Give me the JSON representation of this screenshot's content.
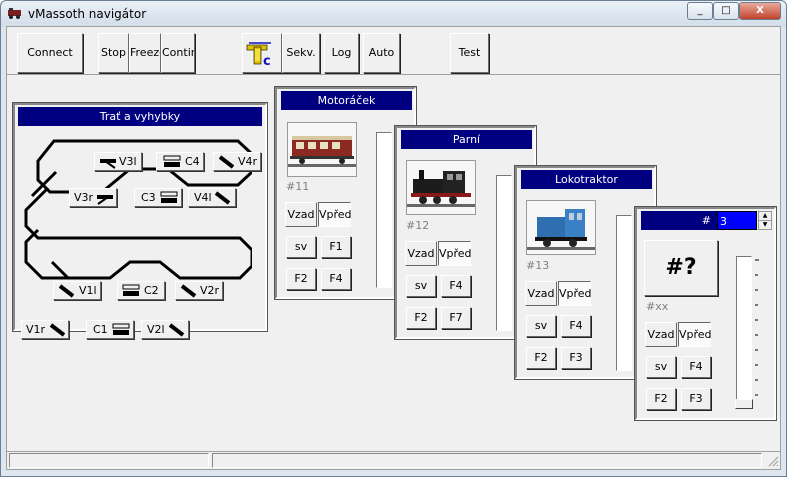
{
  "window": {
    "title": "vMassoth navigátor",
    "minimize": "_",
    "maximize": "□",
    "close": "X"
  },
  "toolbar": {
    "connect": "Connect",
    "stop": "Stop",
    "freeze": "Freeze",
    "continue": "Continu",
    "sekv": "Sekv.",
    "log": "Log",
    "auto": "Auto",
    "test": "Test"
  },
  "track": {
    "title": "Trať a vyhybky",
    "switches": {
      "v3l": "V3l",
      "c4": "C4",
      "v4r": "V4r",
      "v3r": "V3r",
      "c3": "C3",
      "v4l": "V4l",
      "v1l": "V1l",
      "c2": "C2",
      "v2r": "V2r",
      "v1r": "V1r",
      "c1": "C1",
      "v2l": "V2l"
    }
  },
  "locos": [
    {
      "name": "Motoráček",
      "number": "#11",
      "reverse": "Vzad",
      "forward": "Vpřed",
      "light": "sv",
      "f1": "F1",
      "f2": "F2",
      "f3": "F4"
    },
    {
      "name": "Parní",
      "number": "#12",
      "reverse": "Vzad",
      "forward": "Vpřed",
      "light": "sv",
      "f1": "F4",
      "f2": "F2",
      "f3": "F7"
    },
    {
      "name": "Lokotraktor",
      "number": "#13",
      "reverse": "Vzad",
      "forward": "Vpřed",
      "light": "sv",
      "f1": "F4",
      "f2": "F2",
      "f3": "F3"
    }
  ],
  "custom": {
    "hash": "#",
    "value": "3",
    "big_label": "#?",
    "number": "#xx",
    "reverse": "Vzad",
    "forward": "Vpřed",
    "light": "sv",
    "f1": "F4",
    "f2": "F2",
    "f3": "F3"
  },
  "colors": {
    "titlebar_blue": "#000080",
    "selection_blue": "#0000ff"
  }
}
